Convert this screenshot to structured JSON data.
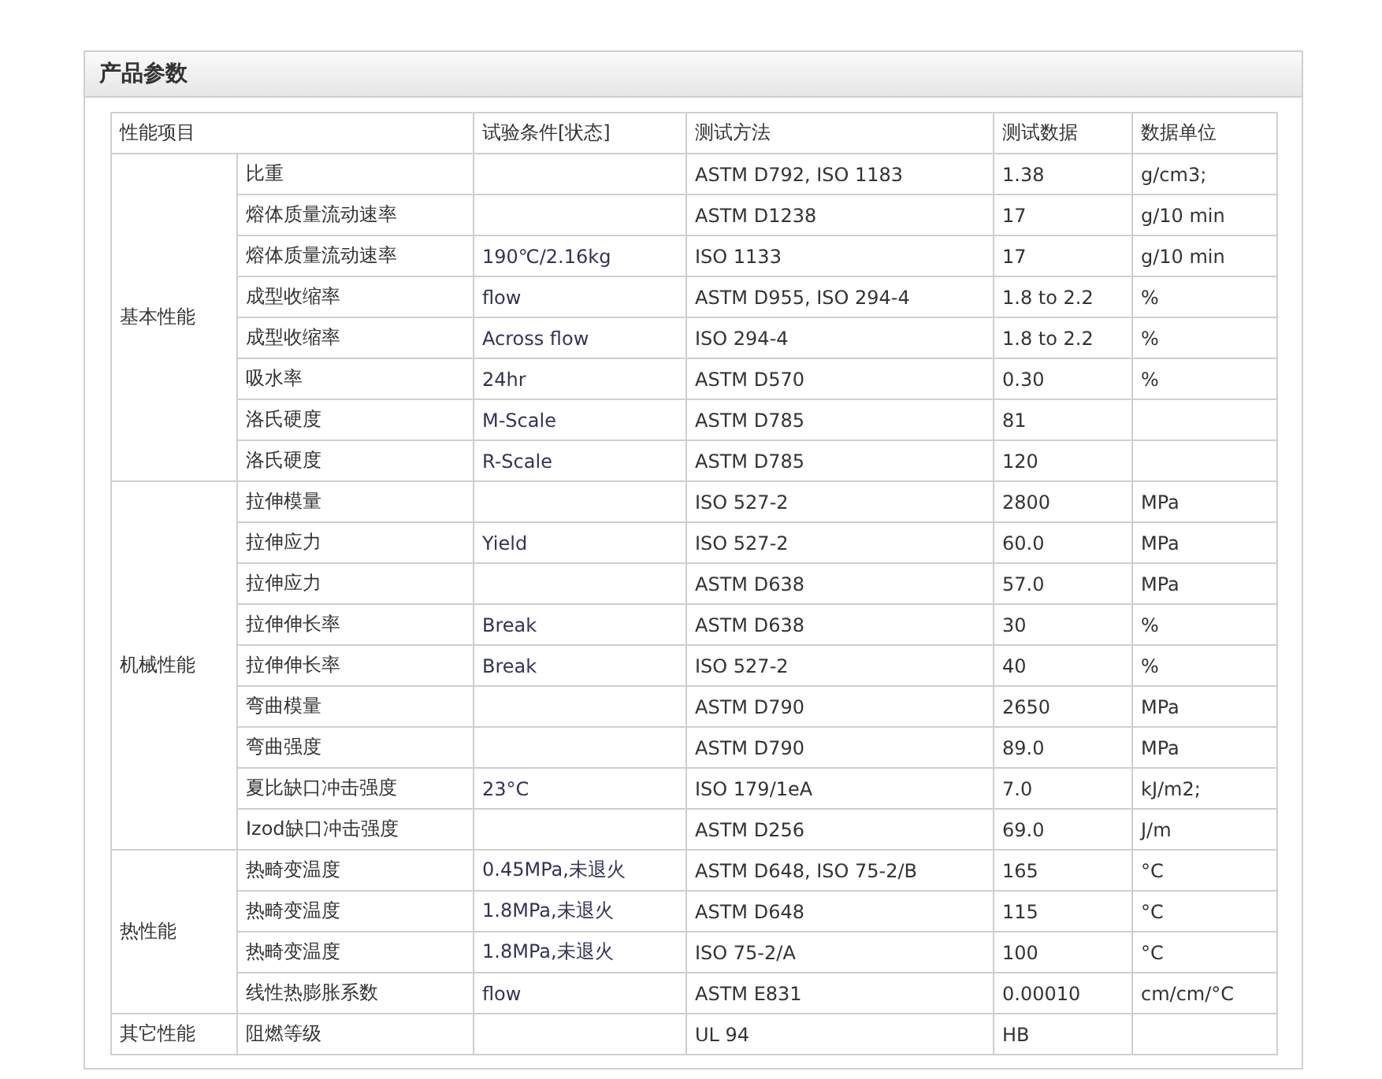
{
  "panel": {
    "title": "产品参数"
  },
  "table": {
    "columns": [
      "性能项目",
      "试验条件[状态]",
      "测试方法",
      "测试数据",
      "数据单位"
    ],
    "groups": [
      {
        "name": "基本性能",
        "rows": [
          {
            "property": "比重",
            "condition": "",
            "method": "ASTM D792, ISO 1183",
            "value": "1.38",
            "unit": "g/cm3;"
          },
          {
            "property": "熔体质量流动速率",
            "condition": "",
            "method": "ASTM D1238",
            "value": "17",
            "unit": "g/10 min"
          },
          {
            "property": "熔体质量流动速率",
            "condition": "190℃/2.16kg",
            "method": "ISO 1133",
            "value": "17",
            "unit": "g/10 min"
          },
          {
            "property": "成型收缩率",
            "condition": "flow",
            "method": "ASTM D955, ISO 294-4",
            "value": "1.8 to 2.2",
            "unit": "%"
          },
          {
            "property": "成型收缩率",
            "condition": "Across flow",
            "method": "ISO 294-4",
            "value": "1.8 to 2.2",
            "unit": "%"
          },
          {
            "property": "吸水率",
            "condition": "24hr",
            "method": "ASTM D570",
            "value": "0.30",
            "unit": "%"
          },
          {
            "property": "洛氏硬度",
            "condition": "M-Scale",
            "method": "ASTM D785",
            "value": "81",
            "unit": ""
          },
          {
            "property": "洛氏硬度",
            "condition": "R-Scale",
            "method": "ASTM D785",
            "value": "120",
            "unit": ""
          }
        ]
      },
      {
        "name": "机械性能",
        "rows": [
          {
            "property": "拉伸模量",
            "condition": "",
            "method": "ISO 527-2",
            "value": "2800",
            "unit": "MPa"
          },
          {
            "property": "拉伸应力",
            "condition": "Yield",
            "method": "ISO 527-2",
            "value": "60.0",
            "unit": "MPa"
          },
          {
            "property": "拉伸应力",
            "condition": "",
            "method": "ASTM D638",
            "value": "57.0",
            "unit": "MPa"
          },
          {
            "property": "拉伸伸长率",
            "condition": "Break",
            "method": "ASTM D638",
            "value": "30",
            "unit": "%"
          },
          {
            "property": "拉伸伸长率",
            "condition": "Break",
            "method": "ISO 527-2",
            "value": "40",
            "unit": "%"
          },
          {
            "property": "弯曲模量",
            "condition": "",
            "method": "ASTM D790",
            "value": "2650",
            "unit": "MPa"
          },
          {
            "property": "弯曲强度",
            "condition": "",
            "method": "ASTM D790",
            "value": "89.0",
            "unit": "MPa"
          },
          {
            "property": "夏比缺口冲击强度",
            "condition": "23°C",
            "method": "ISO 179/1eA",
            "value": "7.0",
            "unit": "kJ/m2;"
          },
          {
            "property": "Izod缺口冲击强度",
            "condition": "",
            "method": "ASTM D256",
            "value": "69.0",
            "unit": "J/m"
          }
        ]
      },
      {
        "name": "热性能",
        "rows": [
          {
            "property": "热畸变温度",
            "condition": "0.45MPa,未退火",
            "method": "ASTM D648, ISO 75-2/B",
            "value": "165",
            "unit": "°C"
          },
          {
            "property": "热畸变温度",
            "condition": "1.8MPa,未退火",
            "method": "ASTM D648",
            "value": "115",
            "unit": "°C"
          },
          {
            "property": "热畸变温度",
            "condition": "1.8MPa,未退火",
            "method": "ISO 75-2/A",
            "value": "100",
            "unit": "°C"
          },
          {
            "property": "线性热膨胀系数",
            "condition": "flow",
            "method": "ASTM E831",
            "value": "0.00010",
            "unit": "cm/cm/°C"
          }
        ]
      },
      {
        "name": "其它性能",
        "rows": [
          {
            "property": "阻燃等级",
            "condition": "",
            "method": "UL 94",
            "value": "HB",
            "unit": ""
          }
        ]
      }
    ]
  }
}
